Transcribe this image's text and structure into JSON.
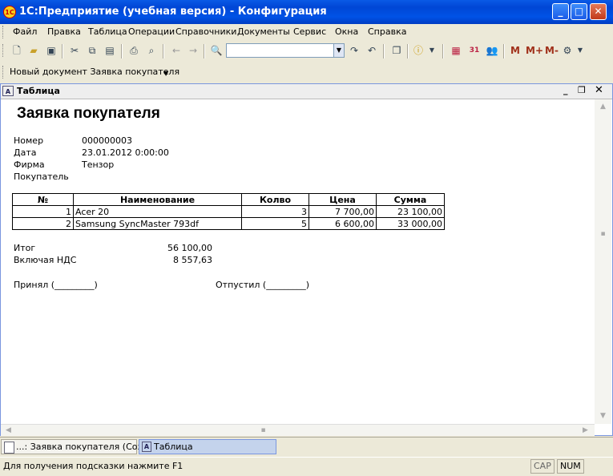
{
  "window": {
    "title": "1С:Предприятие (учебная версия) - Конфигурация",
    "logo": "1С"
  },
  "menu": [
    "Файл",
    "Правка",
    "Таблица",
    "Операции",
    "Справочники",
    "Документы",
    "Сервис",
    "Окна",
    "Справка"
  ],
  "toolbar": {
    "search_value": "",
    "m": "M",
    "m_plus": "M+",
    "m_minus": "M-",
    "calendar_day": "31"
  },
  "newdoc": {
    "label": "Новый документ Заявка покупателя"
  },
  "child_window": {
    "title": "Таблица"
  },
  "document": {
    "heading": "Заявка покупателя",
    "fields": [
      {
        "label": "Номер",
        "value": "000000003"
      },
      {
        "label": "Дата",
        "value": "23.01.2012 0:00:00"
      },
      {
        "label": "Фирма",
        "value": "Тензор"
      },
      {
        "label": "Покупатель",
        "value": ""
      }
    ],
    "table": {
      "headers": [
        "№",
        "Наименование",
        "Колво",
        "Цена",
        "Сумма"
      ],
      "rows": [
        [
          "1",
          "Acer 20",
          "3",
          "7 700,00",
          "23 100,00"
        ],
        [
          "2",
          "Samsung SyncMaster 793df",
          "5",
          "6 600,00",
          "33 000,00"
        ]
      ]
    },
    "totals": [
      {
        "label": "Итог",
        "value": "56 100,00"
      },
      {
        "label": "Включая НДС",
        "value": "8 557,63"
      }
    ],
    "signatures": {
      "received": "Принял (_________)",
      "released": "Отпустил (_________)"
    }
  },
  "taskbar": [
    {
      "label": "...: Заявка покупателя (Соз..."
    },
    {
      "label": "Таблица"
    }
  ],
  "status": {
    "hint": "Для получения подсказки нажмите F1",
    "cap": "CAP",
    "num": "NUM"
  }
}
